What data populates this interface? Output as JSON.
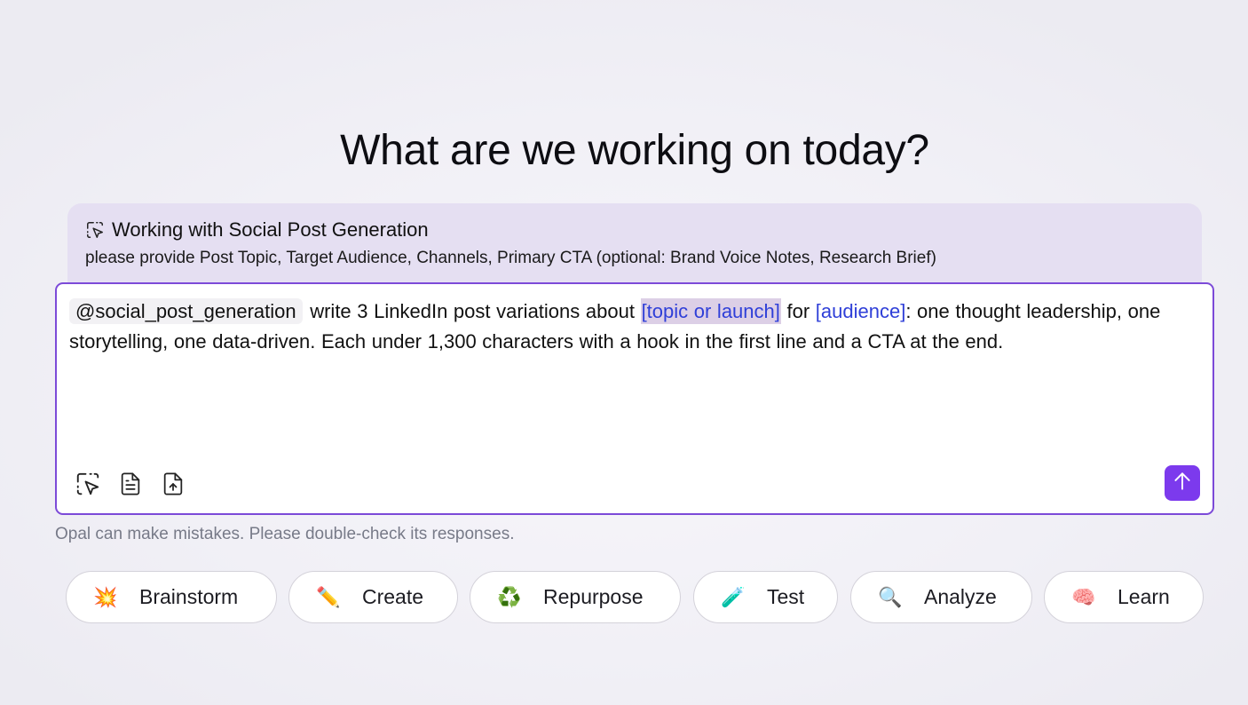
{
  "header": {
    "title": "What are we working on today?"
  },
  "context": {
    "icon": "cursor-select-icon",
    "title": "Working with Social Post Generation",
    "subtitle": "please provide Post Topic, Target Audience, Channels, Primary CTA (optional: Brand Voice Notes, Research Brief)"
  },
  "composer": {
    "mention": "@social_post_generation",
    "text_1": " write 3 LinkedIn post variations about ",
    "placeholder_1": "[topic or launch]",
    "text_2": " for ",
    "placeholder_2": "[audience]",
    "text_3": ": one thought leadership, one storytelling, one data-driven. Each under 1,300 characters with a hook in the first line and a CTA at the end.",
    "tools": [
      "cursor-select-icon",
      "document-icon",
      "file-upload-icon"
    ],
    "send_icon": "arrow-up-icon",
    "accent": "#7c3aed"
  },
  "disclaimer": "Opal can make mistakes. Please double-check its responses.",
  "chips": [
    {
      "emoji": "💥",
      "label": "Brainstorm"
    },
    {
      "emoji": "✏️",
      "label": "Create"
    },
    {
      "emoji": "♻️",
      "label": "Repurpose"
    },
    {
      "emoji": "🧪",
      "label": "Test"
    },
    {
      "emoji": "🔍",
      "label": "Analyze"
    },
    {
      "emoji": "🧠",
      "label": "Learn"
    }
  ]
}
